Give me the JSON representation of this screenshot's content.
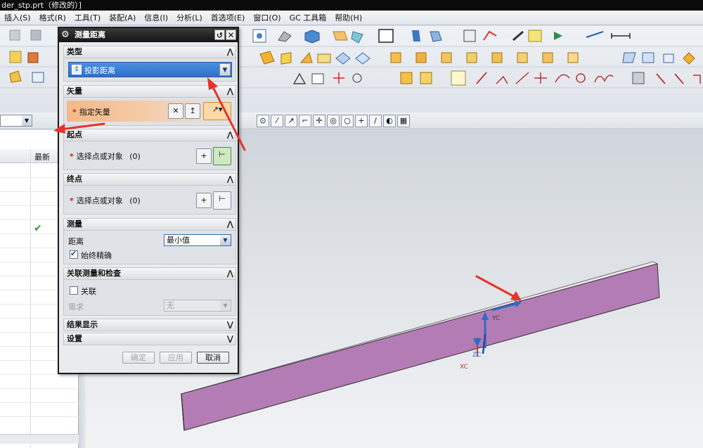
{
  "window": {
    "title": "der_stp.prt（修改的）]"
  },
  "menu": {
    "items": [
      "插入(S)",
      "格式(R)",
      "工具(T)",
      "装配(A)",
      "信息(I)",
      "分析(L)",
      "首选项(E)",
      "窗口(O)",
      "GC 工具箱",
      "帮助(H)"
    ]
  },
  "nav_panel": {
    "column_header": "最新"
  },
  "dialog": {
    "title": "测量距离",
    "sections": {
      "type": {
        "header": "类型",
        "selected": "投影距离"
      },
      "vector": {
        "header": "矢量",
        "label": "指定矢量"
      },
      "start": {
        "header": "起点",
        "label": "选择点或对象",
        "count": "(0)"
      },
      "end": {
        "header": "终点",
        "label": "选择点或对象",
        "count": "(0)"
      },
      "measure": {
        "header": "测量",
        "distance_label": "距离",
        "distance_value": "最小值",
        "always_exact_label": "始终精确",
        "always_exact_checked": true
      },
      "assoc": {
        "header": "关联测量和检查",
        "assoc_label": "关联",
        "requirement_label": "需求",
        "requirement_value": "无"
      },
      "result": {
        "header": "结果显示"
      },
      "settings": {
        "header": "设置"
      }
    },
    "buttons": {
      "ok": "确定",
      "apply": "应用",
      "cancel": "取消"
    }
  },
  "viewport": {
    "axis_labels": {
      "xc": "XC",
      "yc": "YC",
      "zc": "ZC"
    },
    "part_color": "#b47cb4"
  },
  "colors": {
    "arrow": "#e8322c",
    "accent": "#2e6fc7"
  }
}
